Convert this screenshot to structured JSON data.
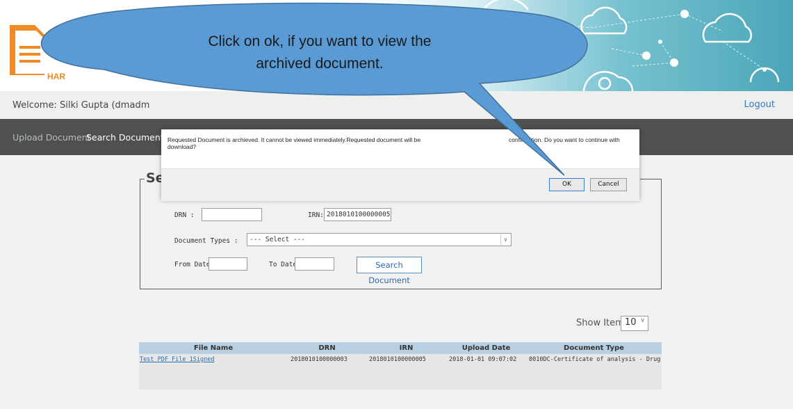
{
  "header": {
    "logo_text": "HAR",
    "welcome": "Welcome:  Silki Gupta (dmadm",
    "logout": "Logout"
  },
  "nav": {
    "upload": "Upload Document",
    "search": "Search Document"
  },
  "search_form": {
    "legend": "Sea",
    "drn_label": "DRN :",
    "drn_value": "",
    "irn_label": "IRN:",
    "irn_value": "2018010100000005",
    "doc_types_label": "Document Types :",
    "doc_types_value": "--- Select ---",
    "from_label": "From Date:",
    "to_label": "To Date:",
    "search_button": "Search Document"
  },
  "show_items": {
    "label": "Show Items:",
    "value": "10"
  },
  "table": {
    "headers": [
      "File Name",
      "DRN",
      "IRN",
      "Upload Date",
      "Document Type"
    ],
    "rows": [
      [
        "Test PDF File 1Signed",
        "2018010100000003",
        "2018010100000005",
        "2018-01-01 09:07:02",
        "0010DC-Certificate of analysis - Drug"
      ]
    ]
  },
  "modal": {
    "message_a": "Requested Document is archieved. It cannot be viewed immediately.Requested document will be",
    "message_b": "confirmation. Do you want to continue with",
    "message_c": "download?",
    "ok": "OK",
    "cancel": "Cancel"
  },
  "callout": {
    "line1": "Click on ok, if you want to view the",
    "line2": "archived document."
  },
  "colors": {
    "callout_fill": "#5b9bd5",
    "navbar": "#4f5150",
    "link": "#2a6cb0"
  }
}
